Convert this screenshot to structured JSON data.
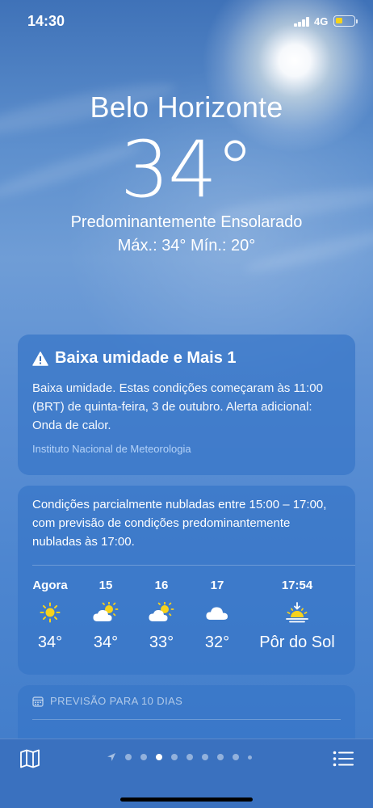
{
  "status_bar": {
    "time": "14:30",
    "network": "4G",
    "battery_level": 0.35,
    "battery_color": "#f6d31a"
  },
  "current": {
    "city": "Belo Horizonte",
    "temperature": "34°",
    "condition": "Predominantemente Ensolarado",
    "high_low": "Máx.: 34°  Mín.: 20°"
  },
  "alert": {
    "icon": "warning-triangle-icon",
    "title": "Baixa umidade e Mais 1",
    "body": "Baixa umidade. Estas condições começaram às 11:00 (BRT) de quinta-feira, 3 de outubro. Alerta adicional: Onda de calor.",
    "source": "Instituto Nacional de Meteorologia"
  },
  "hourly": {
    "summary": "Condições parcialmente nubladas entre 15:00 – 17:00, com previsão de condições predominantemente nubladas às 17:00.",
    "items": [
      {
        "label": "Agora",
        "icon": "sun-icon",
        "temp": "34°"
      },
      {
        "label": "15",
        "icon": "partly-cloudy-icon",
        "temp": "34°"
      },
      {
        "label": "16",
        "icon": "partly-cloudy-icon",
        "temp": "33°"
      },
      {
        "label": "17",
        "icon": "cloud-icon",
        "temp": "32°"
      },
      {
        "label": "17:54",
        "icon": "sunset-icon",
        "temp": "Pôr do Sol"
      }
    ]
  },
  "ten_day": {
    "header": "PREVISÃO PARA 10 DIAS",
    "icon": "calendar-icon"
  },
  "bottom_bar": {
    "map_icon": "map-icon",
    "list_icon": "list-icon",
    "location_icon": "location-arrow-icon",
    "page_count": 9,
    "active_page": 3
  }
}
